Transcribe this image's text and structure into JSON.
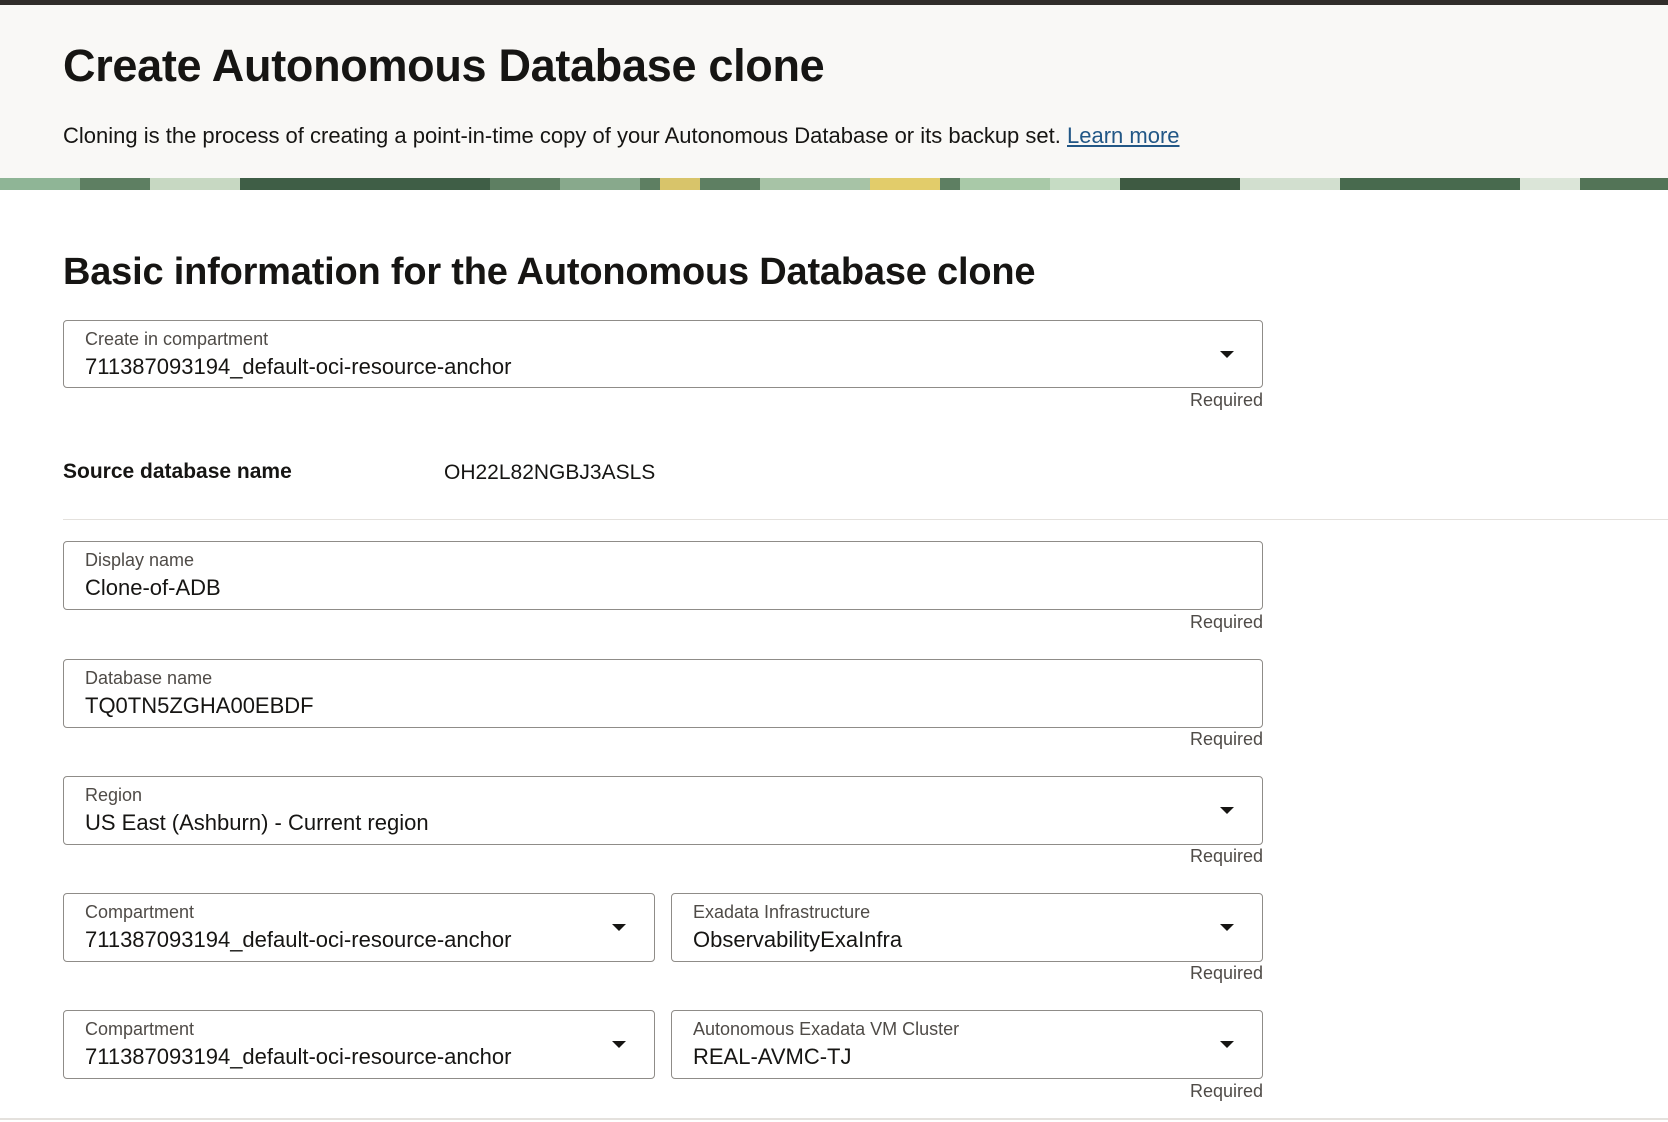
{
  "header": {
    "title": "Create Autonomous Database clone",
    "subtitle": "Cloning is the process of creating a point-in-time copy of your Autonomous Database or its backup set.",
    "learn_more": "Learn more"
  },
  "section": {
    "title": "Basic information for the Autonomous Database clone"
  },
  "form": {
    "create_compartment": {
      "label": "Create in compartment",
      "value": "711387093194_default-oci-resource-anchor",
      "required": "Required"
    },
    "source_db": {
      "label": "Source database name",
      "value": "OH22L82NGBJ3ASLS"
    },
    "display_name": {
      "label": "Display name",
      "value": "Clone-of-ADB",
      "required": "Required"
    },
    "database_name": {
      "label": "Database name",
      "value": "TQ0TN5ZGHA00EBDF",
      "required": "Required"
    },
    "region": {
      "label": "Region",
      "value": "US East (Ashburn) - Current region",
      "required": "Required"
    },
    "infra_compartment": {
      "label": "Compartment",
      "value": "711387093194_default-oci-resource-anchor"
    },
    "exadata_infrastructure": {
      "label": "Exadata Infrastructure",
      "value": "ObservabilityExaInfra",
      "required": "Required"
    },
    "cluster_compartment": {
      "label": "Compartment",
      "value": "711387093194_default-oci-resource-anchor"
    },
    "vm_cluster": {
      "label": "Autonomous Exadata VM Cluster",
      "value": "REAL-AVMC-TJ",
      "required": "Required"
    }
  },
  "icons": {
    "dropdown": "chevron-down-icon"
  }
}
